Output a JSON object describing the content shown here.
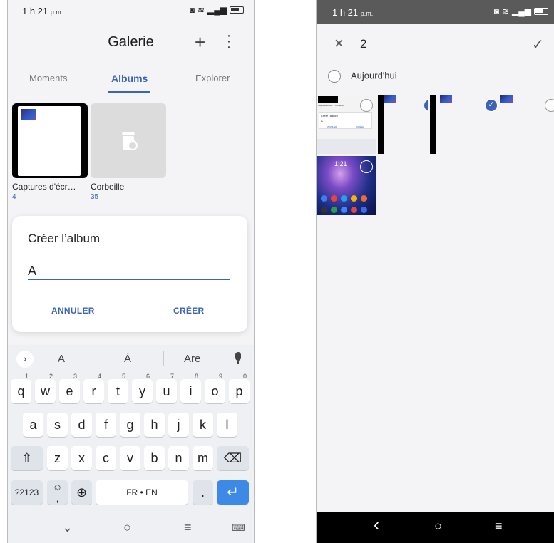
{
  "left": {
    "status": {
      "time": "1 h 21",
      "ampm": "p.m."
    },
    "appbar": {
      "title": "Galerie",
      "add": "+",
      "more": "⋮"
    },
    "tabs": [
      "Moments",
      "Albums",
      "Explorer"
    ],
    "albums": [
      {
        "name": "Captures d'écr…",
        "count": "4"
      },
      {
        "name": "Corbeille",
        "count": "35"
      }
    ],
    "dialog": {
      "title": "Créer l’album",
      "value": "A",
      "cancel": "ANNULER",
      "create": "CRÉER"
    },
    "suggestions": [
      "A",
      "À",
      "Are"
    ],
    "keys": {
      "row1": [
        "q",
        "w",
        "e",
        "r",
        "t",
        "y",
        "u",
        "i",
        "o",
        "p"
      ],
      "row1_nums": [
        "1",
        "2",
        "3",
        "4",
        "5",
        "6",
        "7",
        "8",
        "9",
        "0"
      ],
      "row2": [
        "a",
        "s",
        "d",
        "f",
        "g",
        "h",
        "j",
        "k",
        "l"
      ],
      "row3": [
        "z",
        "x",
        "c",
        "v",
        "b",
        "n",
        "m"
      ],
      "shift": "⇧",
      "backspace": "⌫",
      "sym": "?2123",
      "emoji_comma": ",",
      "emoji": "☺",
      "globe": "⊕",
      "space": "FR • EN",
      "period": ".",
      "enter": "↵"
    },
    "nav": {
      "hide": "⌄",
      "home": "○",
      "menu": "≡",
      "kbd": "⌨"
    }
  },
  "right": {
    "status": {
      "time": "1 h 21",
      "ampm": "p.m."
    },
    "selection": {
      "close": "×",
      "count": "2",
      "done": "✓"
    },
    "day": "Aujourd'hui",
    "mini": {
      "title": "Créer l'album",
      "input": "A",
      "cancel": "ANNULER",
      "create": "CRÉER",
      "clock": "1:21",
      "captures": "Captures d'écr...",
      "trash": "Corbeille"
    },
    "nav": {
      "back": "‹",
      "home": "○",
      "menu": "≡"
    }
  },
  "icons": {
    "wifi": "wifi-icon",
    "signal": "signal-icon",
    "battery": "battery-icon",
    "nfc": "nfc-icon"
  },
  "colors": {
    "accent": "#3d63b6",
    "enter": "#3d8ae6"
  }
}
